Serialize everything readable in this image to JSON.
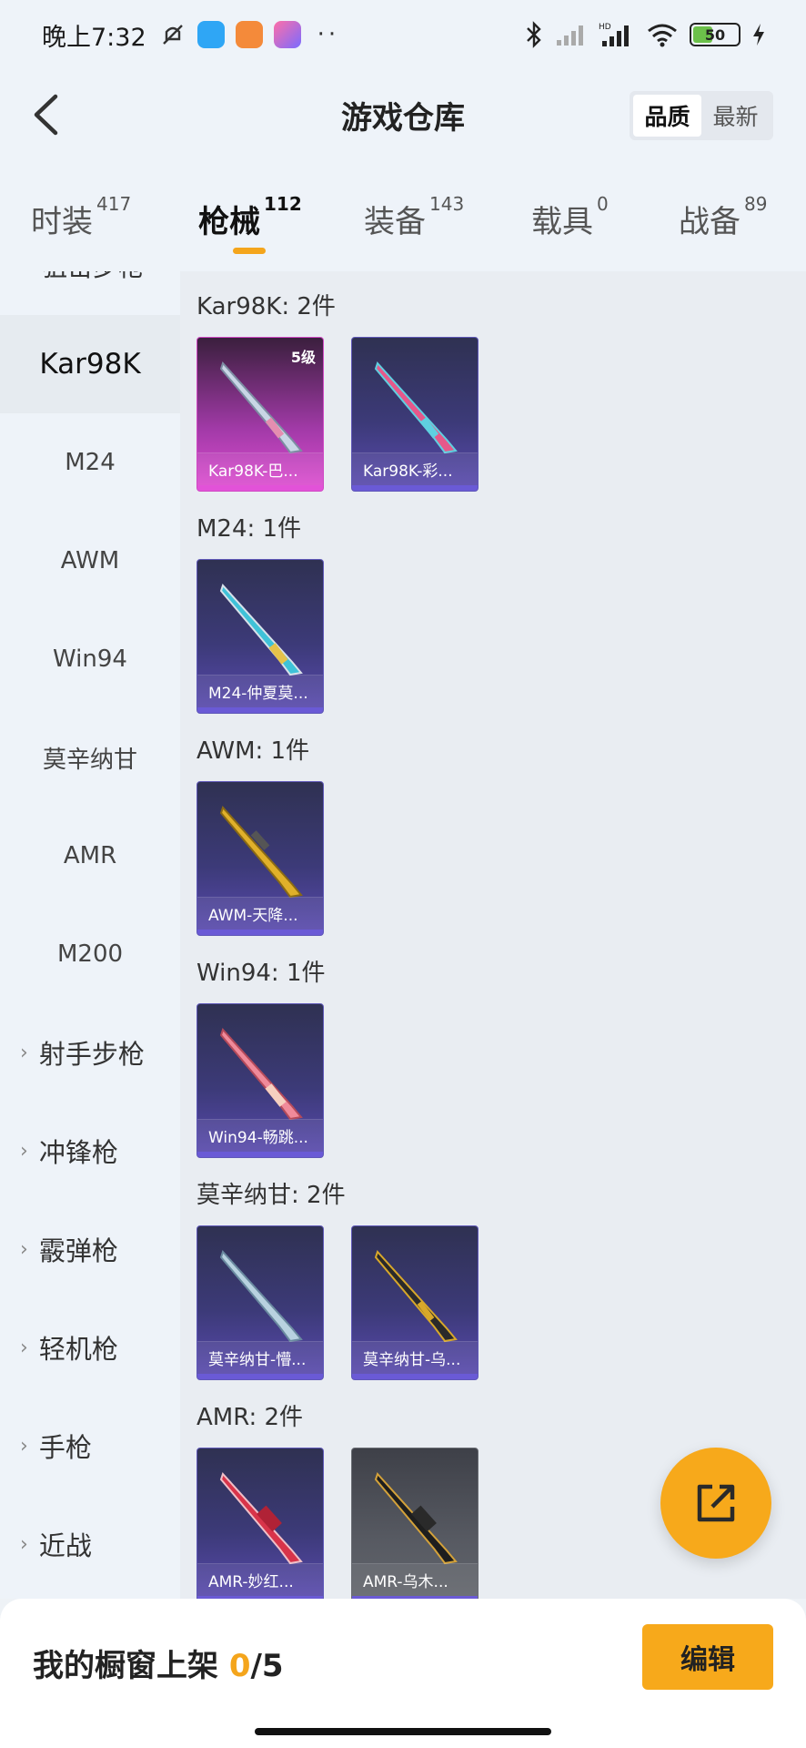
{
  "status_bar": {
    "time": "晚上7:32",
    "battery": "50"
  },
  "header": {
    "title": "游戏仓库",
    "sort_options": [
      "品质",
      "最新"
    ],
    "sort_active": "品质"
  },
  "tabs": [
    {
      "label": "时装",
      "count": "417"
    },
    {
      "label": "枪械",
      "count": "112"
    },
    {
      "label": "装备",
      "count": "143"
    },
    {
      "label": "载具",
      "count": "0"
    },
    {
      "label": "战备",
      "count": "89"
    }
  ],
  "active_tab": "枪械",
  "sidebar": {
    "partial_item": "狙击步枪",
    "items": [
      "Kar98K",
      "M24",
      "AWM",
      "Win94",
      "莫辛纳甘",
      "AMR",
      "M200"
    ],
    "active": "Kar98K",
    "groups": [
      "射手步枪",
      "冲锋枪",
      "霰弹枪",
      "轻机枪",
      "手枪",
      "近战"
    ]
  },
  "sections": [
    {
      "title": "Kar98K: 2件",
      "cards": [
        {
          "label": "Kar98K-巴...",
          "level": "5级",
          "tint": "pink"
        },
        {
          "label": "Kar98K-彩...",
          "tint": "purple"
        }
      ]
    },
    {
      "title": "M24: 1件",
      "cards": [
        {
          "label": "M24-仲夏莫...",
          "tint": "purple"
        }
      ]
    },
    {
      "title": "AWM: 1件",
      "cards": [
        {
          "label": "AWM-天降...",
          "tint": "purple"
        }
      ]
    },
    {
      "title": "Win94: 1件",
      "cards": [
        {
          "label": "Win94-畅跳...",
          "tint": "purple"
        }
      ]
    },
    {
      "title": "莫辛纳甘: 2件",
      "cards": [
        {
          "label": "莫辛纳甘-懵...",
          "tint": "purple"
        },
        {
          "label": "莫辛纳甘-乌...",
          "tint": "purple"
        }
      ]
    },
    {
      "title": "AMR: 2件",
      "cards": [
        {
          "label": "AMR-妙红...",
          "tint": "purple"
        },
        {
          "label": "AMR-乌木...",
          "tint": "gray"
        }
      ]
    }
  ],
  "bottom_bar": {
    "showcase_label": "我的橱窗上架",
    "showcase_current": "0",
    "showcase_total": "/5",
    "edit_label": "编辑"
  },
  "colors": {
    "accent": "#f7a91b",
    "background": "#eef3f9",
    "content_bg": "#e9edf2"
  }
}
